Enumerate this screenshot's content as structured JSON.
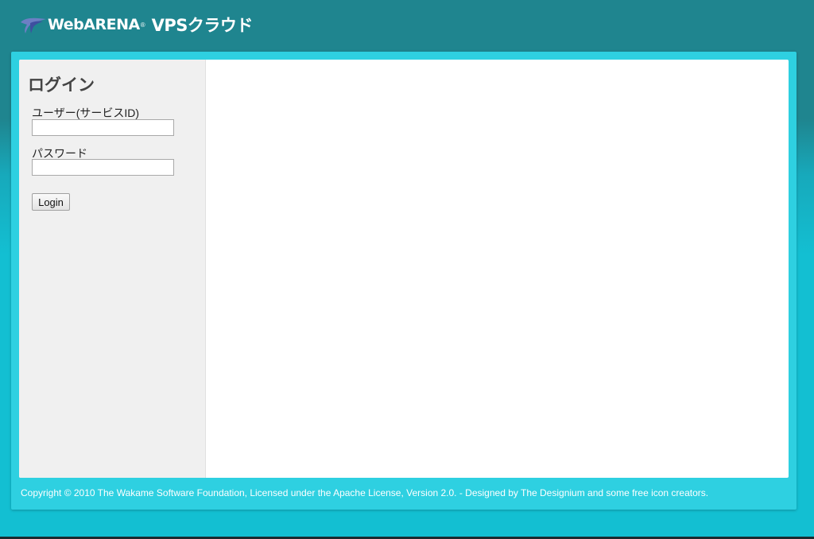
{
  "header": {
    "brand": "WebARENA",
    "registered": "®",
    "product": "VPSクラウド",
    "logo_icon": "wing-logo-icon"
  },
  "login": {
    "title": "ログイン",
    "user_label": "ユーザー(サービスID)",
    "user_value": "",
    "password_label": "パスワード",
    "password_value": "",
    "button_label": "Login"
  },
  "footer": {
    "copyright": "Copyright © 2010 The Wakame Software Foundation, Licensed under the Apache License, Version 2.0. - Designed by The Designium and some free icon creators."
  },
  "colors": {
    "header_bg": "#1f858f",
    "frame_bg": "#2ed0e1",
    "body_bg": "#13bfd2",
    "sidebar_bg": "#f0f0f0",
    "panel_bg": "#ffffff"
  }
}
